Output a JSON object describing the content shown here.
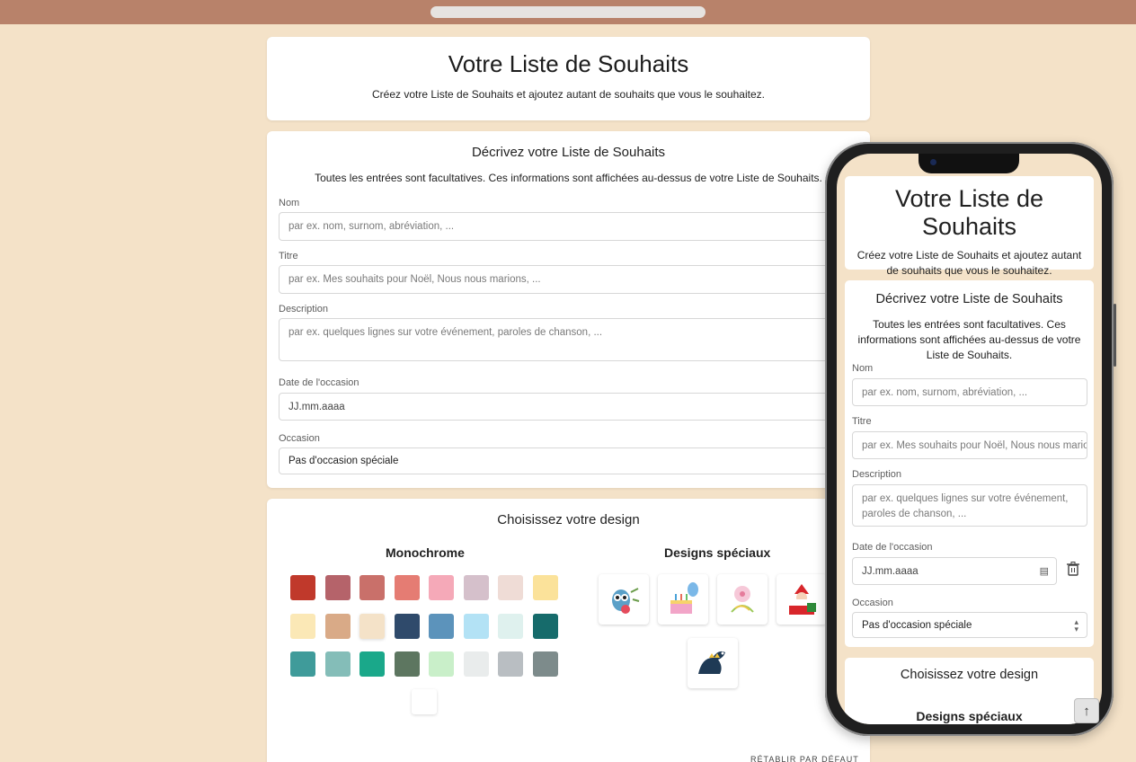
{
  "header": {
    "title": "Votre Liste de Souhaits",
    "subtitle": "Créez votre Liste de Souhaits et ajoutez autant de souhaits que vous le souhaitez."
  },
  "form": {
    "title": "Décrivez votre Liste de Souhaits",
    "intro": "Toutes les entrées sont facultatives. Ces informations sont affichées au-dessus de votre Liste de Souhaits.",
    "fields": [
      {
        "label": "Nom",
        "placeholder": "par ex. nom, surnom, abréviation, ..."
      },
      {
        "label": "Titre",
        "placeholder": "par ex. Mes souhaits pour Noël, Nous nous marions, ..."
      },
      {
        "label": "Description",
        "placeholder": "par ex. quelques lignes sur votre événement, paroles de chanson, ..."
      },
      {
        "label": "Date de l'occasion",
        "placeholder": "JJ.mm.aaaa"
      },
      {
        "label": "Occasion",
        "value": "Pas d'occasion spéciale"
      }
    ]
  },
  "design": {
    "title": "Choisissez votre design",
    "monochrome_title": "Monochrome",
    "special_title": "Designs spéciaux",
    "swatches": [
      "#c0392b",
      "#b5636a",
      "#c9706a",
      "#e57c73",
      "#f5a9b8",
      "#d5c0cb",
      "#efdcd6",
      "#fbe29a",
      "#fbe8b6",
      "#d9aa87",
      "#f4e2c8",
      "#2f4a6b",
      "#5c93bb",
      "#b3e2f5",
      "#dff1ee",
      "#166b6b",
      "#3f9b9a",
      "#84bdb8",
      "#1aa88a",
      "#5d7660",
      "#c9efc9",
      "#e9ecec",
      "#b9bec2",
      "#7d8b8b",
      "#ffffff"
    ],
    "specials": [
      "owl-design-icon",
      "birthday-cake-design-icon",
      "flower-design-icon",
      "santa-design-icon",
      "dinosaur-design-icon"
    ],
    "reset_label": "RÉTABLIR PAR DÉFAUT"
  },
  "phone": {
    "header_title": "Votre Liste de Souhaits",
    "header_subtitle": "Créez votre Liste de Souhaits et ajoutez autant de souhaits que vous le souhaitez.",
    "form_title": "Décrivez votre Liste de Souhaits",
    "form_intro": "Toutes les entrées sont facultatives. Ces informations sont affichées au-dessus de votre Liste de Souhaits.",
    "fields": [
      {
        "label": "Nom",
        "placeholder": "par ex. nom, surnom, abréviation, ..."
      },
      {
        "label": "Titre",
        "placeholder": "par ex. Mes souhaits pour Noël, Nous nous marions, ..."
      },
      {
        "label": "Description",
        "placeholder": "par ex. quelques lignes sur votre événement, paroles de chanson, ..."
      },
      {
        "label": "Date de l'occasion",
        "placeholder": "JJ.mm.aaaa"
      },
      {
        "label": "Occasion",
        "value": "Pas d'occasion spéciale"
      }
    ],
    "design_title": "Choisissez votre design",
    "special_title": "Designs spéciaux"
  }
}
